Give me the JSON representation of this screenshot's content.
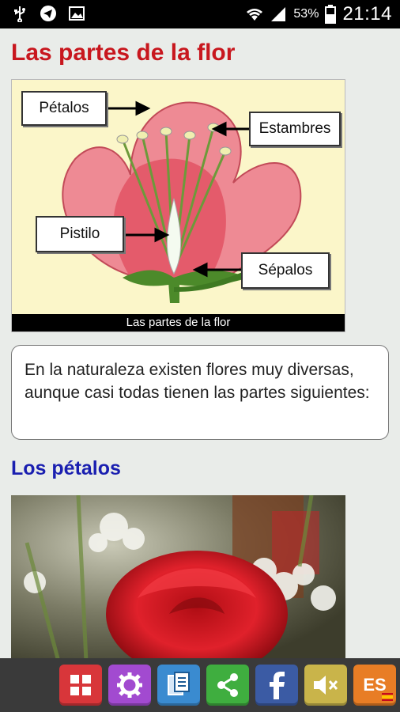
{
  "status_bar": {
    "battery_percent": "53%",
    "time": "21:14",
    "icons": [
      "usb-icon",
      "telegram-icon",
      "image-icon",
      "wifi-icon",
      "signal-icon",
      "battery-icon"
    ]
  },
  "page": {
    "title": "Las partes de la flor",
    "figure": {
      "caption": "Las partes de la flor",
      "labels": {
        "petals": "Pétalos",
        "stamens": "Estambres",
        "pistil": "Pistilo",
        "sepals": "Sépalos"
      }
    },
    "intro_text": "En la naturaleza existen flores muy diversas, aunque casi todas tienen las partes siguientes:",
    "section_title": "Los pétalos"
  },
  "toolbar": {
    "buttons": [
      {
        "name": "grid",
        "color": "#d8363a"
      },
      {
        "name": "settings",
        "color": "#a24ad0"
      },
      {
        "name": "copy",
        "color": "#3a8bd0"
      },
      {
        "name": "share",
        "color": "#3fae3f"
      },
      {
        "name": "facebook",
        "color": "#3b5ba4"
      },
      {
        "name": "sound-off",
        "color": "#c9b44a"
      },
      {
        "name": "language",
        "color": "#e87d25",
        "label": "ES"
      }
    ]
  },
  "colors": {
    "title_red": "#c8171e",
    "section_blue": "#1a1fb0"
  }
}
